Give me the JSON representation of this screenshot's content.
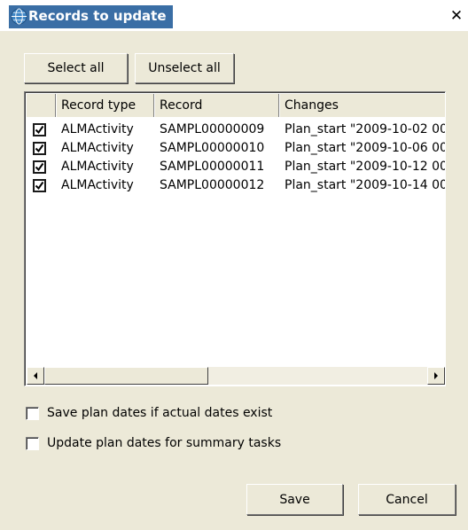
{
  "window": {
    "title": "Records to update",
    "close_glyph": "✕",
    "icon": "globe-icon"
  },
  "toolbar": {
    "select_all_label": "Select all",
    "unselect_all_label": "Unselect all"
  },
  "table": {
    "columns": [
      "Record type",
      "Record",
      "Changes"
    ],
    "rows": [
      {
        "checked": true,
        "record_type": "ALMActivity",
        "record": "SAMPL00000009",
        "changes": "Plan_start \"2009-10-02 00"
      },
      {
        "checked": true,
        "record_type": "ALMActivity",
        "record": "SAMPL00000010",
        "changes": "Plan_start \"2009-10-06 00"
      },
      {
        "checked": true,
        "record_type": "ALMActivity",
        "record": "SAMPL00000011",
        "changes": "Plan_start \"2009-10-12 00"
      },
      {
        "checked": true,
        "record_type": "ALMActivity",
        "record": "SAMPL00000012",
        "changes": "Plan_start \"2009-10-14 00"
      }
    ]
  },
  "options": {
    "save_plan_dates_label": "Save plan dates if actual dates exist",
    "save_plan_dates_checked": false,
    "update_summary_label": "Update plan dates for summary tasks",
    "update_summary_checked": false
  },
  "footer": {
    "save_label": "Save",
    "cancel_label": "Cancel"
  },
  "colors": {
    "dialog_bg": "#ece9d8",
    "title_highlight": "#3a6ea5"
  }
}
